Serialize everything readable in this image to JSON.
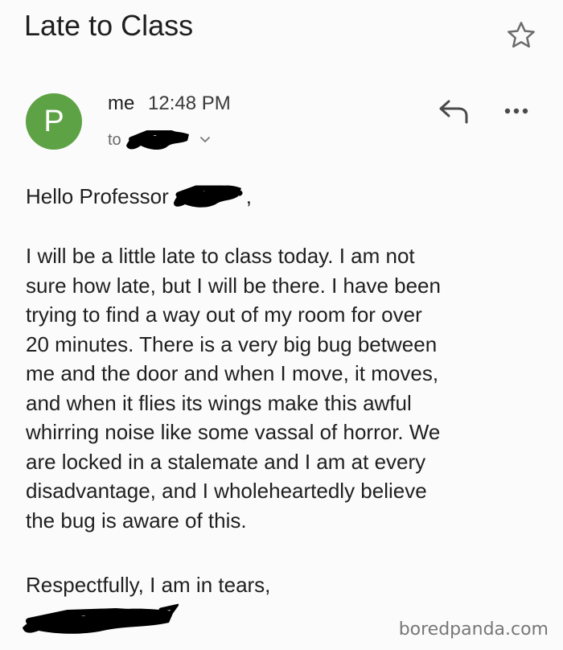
{
  "email": {
    "subject": "Late to Class",
    "sender_avatar_letter": "P",
    "sender_name": "me",
    "time": "12:48 PM",
    "to_label": "to",
    "greeting": "Hello Professor",
    "greeting_suffix": ",",
    "body_lines": [
      "I will be a little late to class today. I am not",
      "sure how late, but I will be there. I have been",
      "trying to find a way out of my room for over",
      "20 minutes. There is a very big bug between",
      "me and the door and when I move, it moves,",
      "and when it flies its wings make this awful",
      "whirring noise like some vassal of horror. We",
      "are locked in a stalemate and I am at every",
      "disadvantage, and I wholeheartedly believe",
      "the bug is aware of this."
    ],
    "signoff": "Respectfully, I am in tears,"
  },
  "icons": {
    "star": "star-outline-icon",
    "reply": "reply-arrow-icon",
    "more": "more-options-icon",
    "expand": "chevron-down-icon"
  },
  "colors": {
    "avatar": "#5da244",
    "redaction": "#000000",
    "background": "#fbfbfc"
  },
  "watermark": "boredpanda.com"
}
